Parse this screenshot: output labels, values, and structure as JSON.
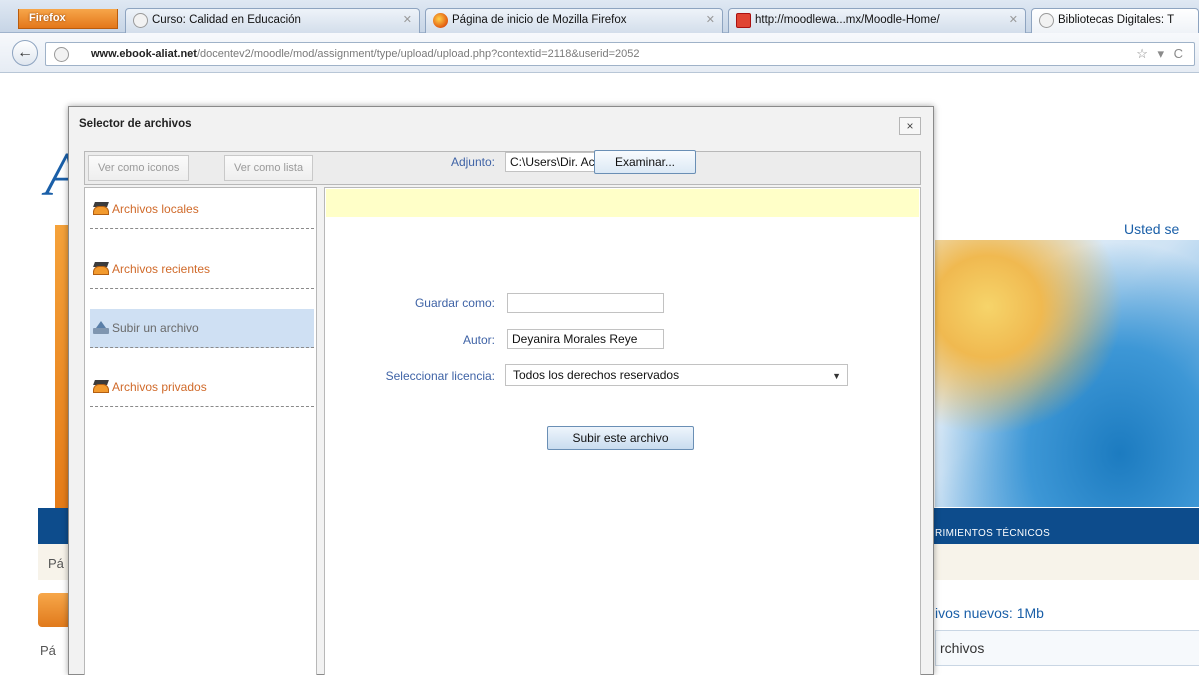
{
  "browser": {
    "firefox_button": "Firefox",
    "tabs": [
      {
        "label": "Curso: Calidad en Educación"
      },
      {
        "label": "Página de inicio de Mozilla Firefox"
      },
      {
        "label": "http://moodlewa...mx/Moodle-Home/"
      },
      {
        "label": "Bibliotecas Digitales: T"
      }
    ],
    "url_domain": "www.ebook-aliat.net",
    "url_path": "/docentev2/moodle/mod/assignment/type/upload/upload.php?contextid=2118&userid=2052"
  },
  "background_page": {
    "logo_letter": "A",
    "usted": "Usted se",
    "menu_text": "RIMIENTOS TÉCNICOS",
    "pa1": "Pá",
    "pa2": "Pá",
    "archivos_nuevos": "ivos nuevos: 1Mb",
    "archivos": "rchivos"
  },
  "dialog": {
    "title": "Selector de archivos",
    "close": "×",
    "view_icons": "Ver como iconos",
    "view_list": "Ver como lista",
    "repositories": [
      {
        "label": "Archivos locales",
        "icon": "moodle-hat-icon"
      },
      {
        "label": "Archivos recientes",
        "icon": "moodle-hat-icon"
      },
      {
        "label": "Subir un archivo",
        "icon": "upload-icon",
        "selected": true
      },
      {
        "label": "Archivos privados",
        "icon": "moodle-hat-icon"
      }
    ],
    "form": {
      "attachment_label": "Adjunto:",
      "attachment_value": "C:\\Users\\Dir. Acad Cor",
      "browse_button": "Examinar...",
      "save_as_label": "Guardar como:",
      "save_as_value": "",
      "author_label": "Autor:",
      "author_value": "Deyanira  Morales Reye",
      "license_label": "Seleccionar licencia:",
      "license_value": "Todos los derechos reservados",
      "upload_button": "Subir este archivo"
    }
  },
  "colors": {
    "link_orange": "#d06a2a",
    "label_blue": "#3f63a6",
    "notice_yellow": "#ffffc8",
    "selected_row": "#cfe0f3",
    "moodle_blue": "#0d4c8c"
  }
}
